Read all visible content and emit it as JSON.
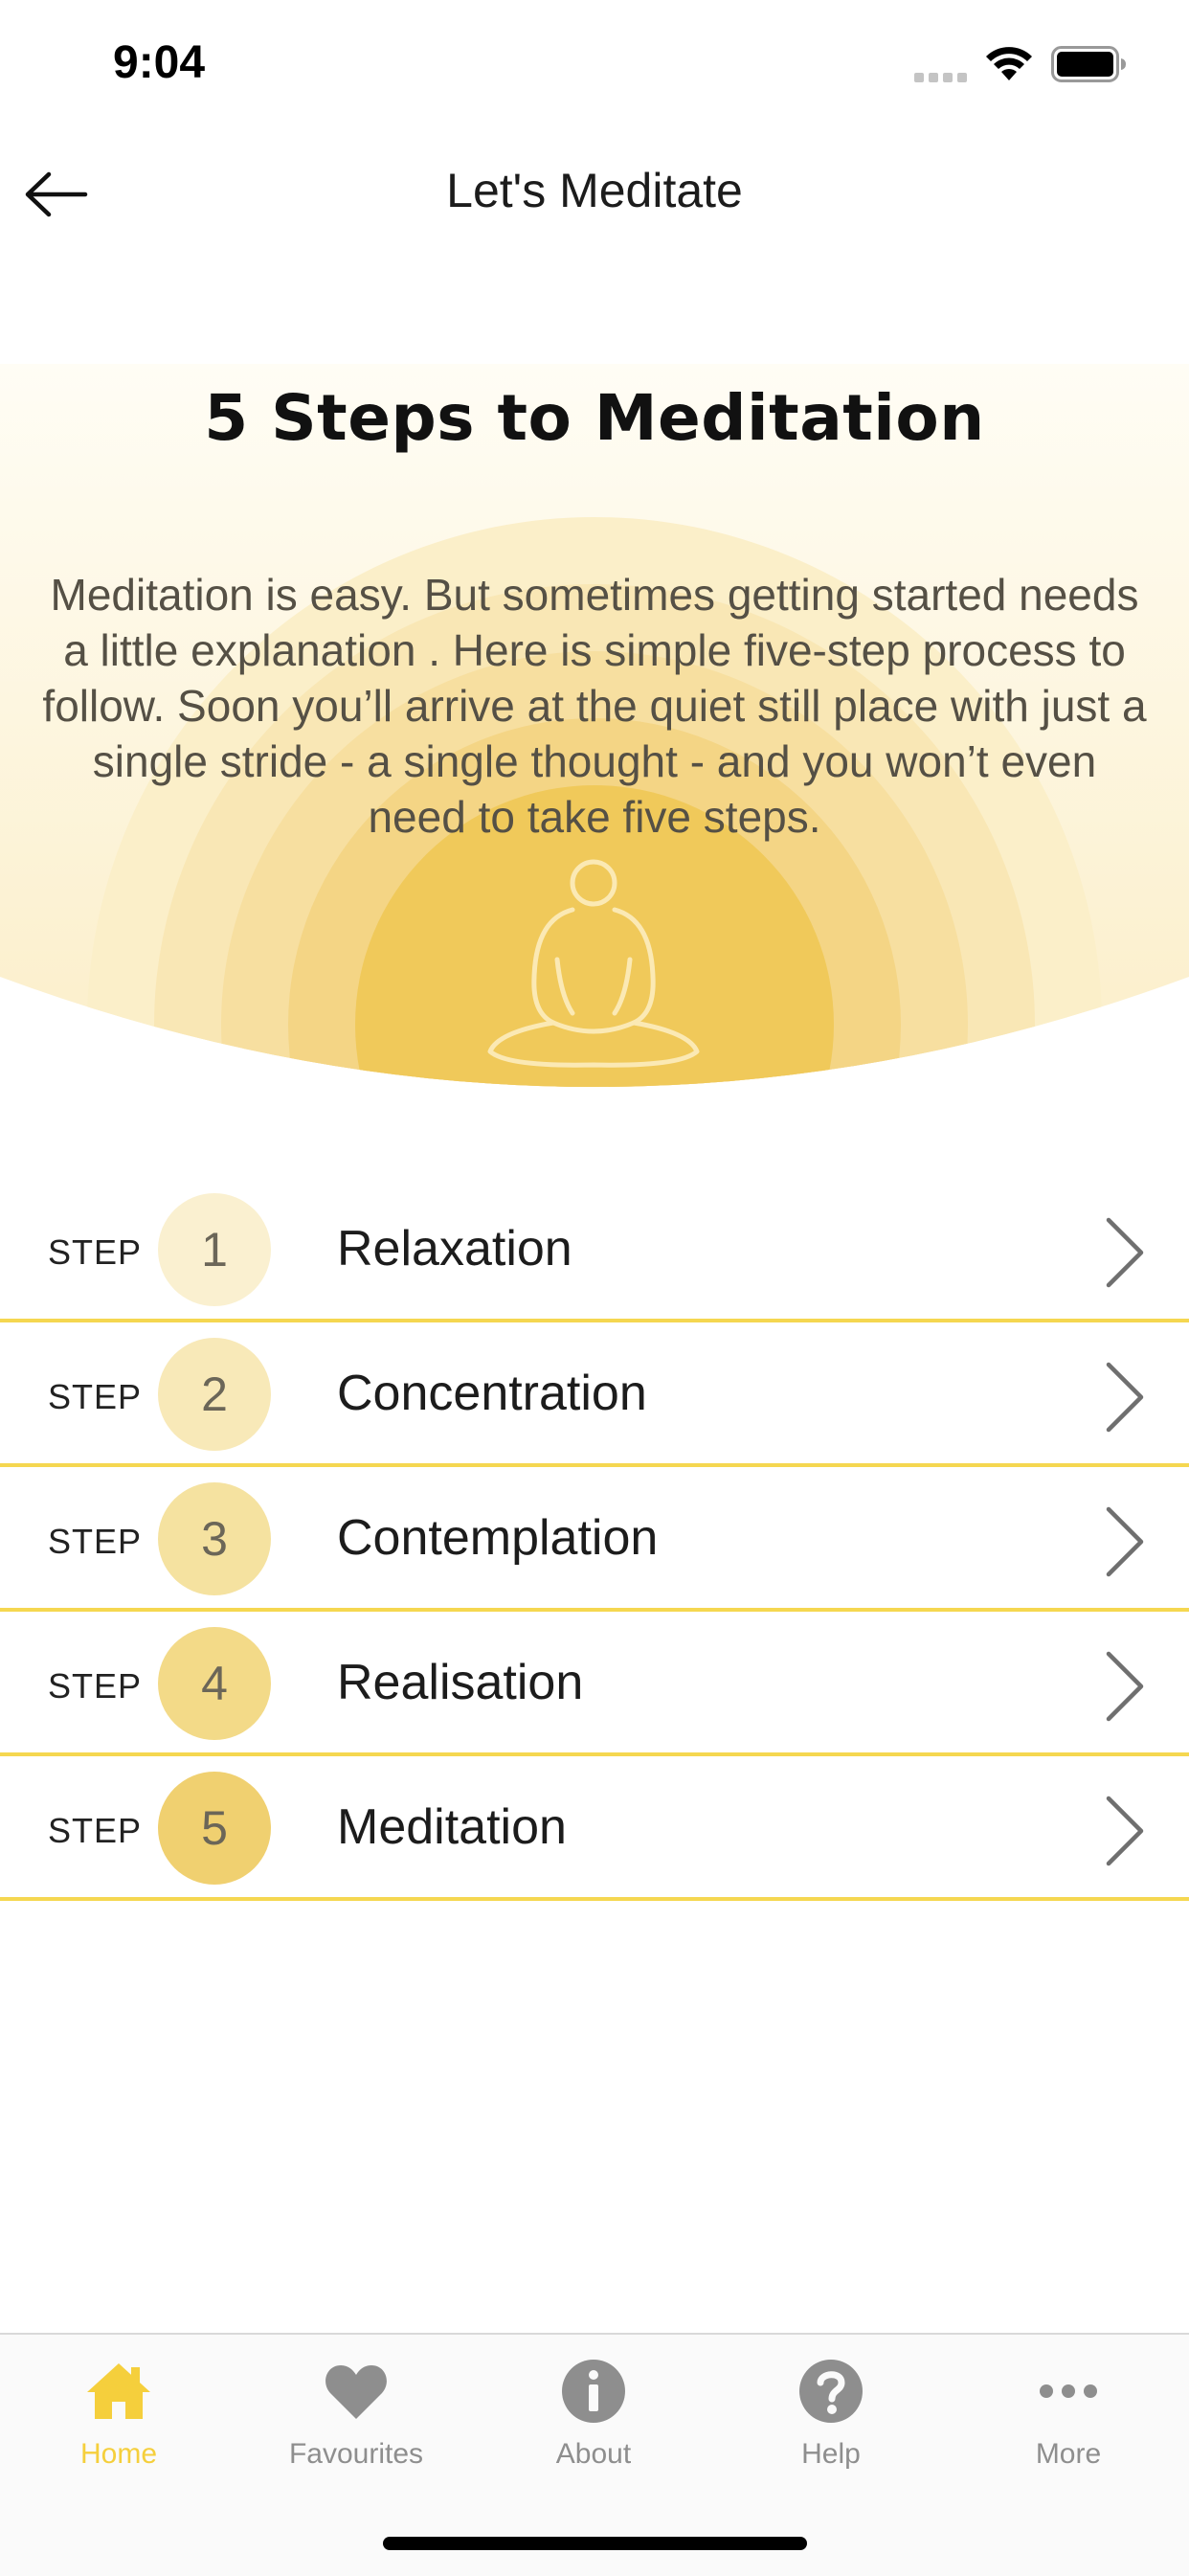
{
  "status_bar": {
    "time": "9:04"
  },
  "nav": {
    "title": "Let's Meditate",
    "back_icon": "arrow-left-icon"
  },
  "hero": {
    "title": "5 Steps to Meditation",
    "description": "Meditation is easy. But sometimes getting started needs a little explanation . Here is simple five-step process to follow. Soon you’ll arrive at the quiet still place with just a single stride - a single thought - and you won’t even need to take five steps.",
    "icon": "meditating-person-icon"
  },
  "steps": [
    {
      "label": "STEP",
      "number": "1",
      "name": "Relaxation",
      "circle_color": "#faf0d0"
    },
    {
      "label": "STEP",
      "number": "2",
      "name": "Concentration",
      "circle_color": "#f8e9b8"
    },
    {
      "label": "STEP",
      "number": "3",
      "name": "Contemplation",
      "circle_color": "#f5e2a0"
    },
    {
      "label": "STEP",
      "number": "4",
      "name": "Realisation",
      "circle_color": "#f3da88"
    },
    {
      "label": "STEP",
      "number": "5",
      "name": "Meditation",
      "circle_color": "#f0d070"
    }
  ],
  "tab_bar": {
    "active_color": "#f5cf3c",
    "inactive_color": "#8e8e8e",
    "tabs": [
      {
        "label": "Home",
        "icon": "home-icon",
        "active": true
      },
      {
        "label": "Favourites",
        "icon": "heart-icon",
        "active": false
      },
      {
        "label": "About",
        "icon": "info-icon",
        "active": false
      },
      {
        "label": "Help",
        "icon": "question-icon",
        "active": false
      },
      {
        "label": "More",
        "icon": "more-dots-icon",
        "active": false
      }
    ]
  },
  "colors": {
    "accent": "#f5d750",
    "hero_gold": "#f0c95a"
  }
}
